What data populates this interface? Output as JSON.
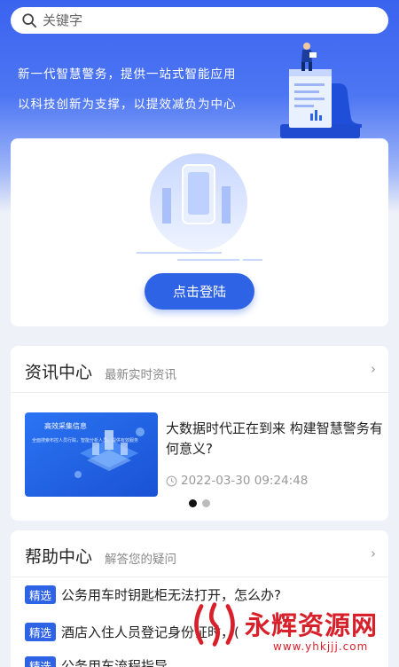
{
  "search": {
    "placeholder": "关键字"
  },
  "hero": {
    "line1": "新一代智慧警务，提供一站式智能应用",
    "line2": "以科技创新为支撑，以提效减负为中心"
  },
  "login": {
    "button_label": "点击登陆"
  },
  "news": {
    "title": "资讯中心",
    "subtitle": "最新实时资讯",
    "item": {
      "thumb_title": "高效采集信息",
      "thumb_sub": "全面搜索布控人员行踪，智能分析人员，提供有效服务",
      "headline": "大数据时代正在到来 构建智慧警务有何意义?",
      "date": "2022-03-30 09:24:48"
    },
    "pager": {
      "total": 2,
      "active": 1
    }
  },
  "help": {
    "title": "帮助中心",
    "subtitle": "解答您的疑问",
    "items": [
      {
        "badge": "精选",
        "text": "公务用车时钥匙柜无法打开，怎么办?"
      },
      {
        "badge": "精选",
        "text": "酒店入住人员登记身份证时，("
      },
      {
        "badge": "精选",
        "text": "公务用车流程指导"
      }
    ]
  },
  "watermark": {
    "name": "永辉资源网",
    "url": "www.yhkjjj.com"
  },
  "colors": {
    "primary": "#2f63e6",
    "hero": "#3a63ef",
    "watermark": "#d8202a"
  },
  "icons": [
    "search-icon",
    "chevron-right-icon",
    "clock-icon"
  ]
}
